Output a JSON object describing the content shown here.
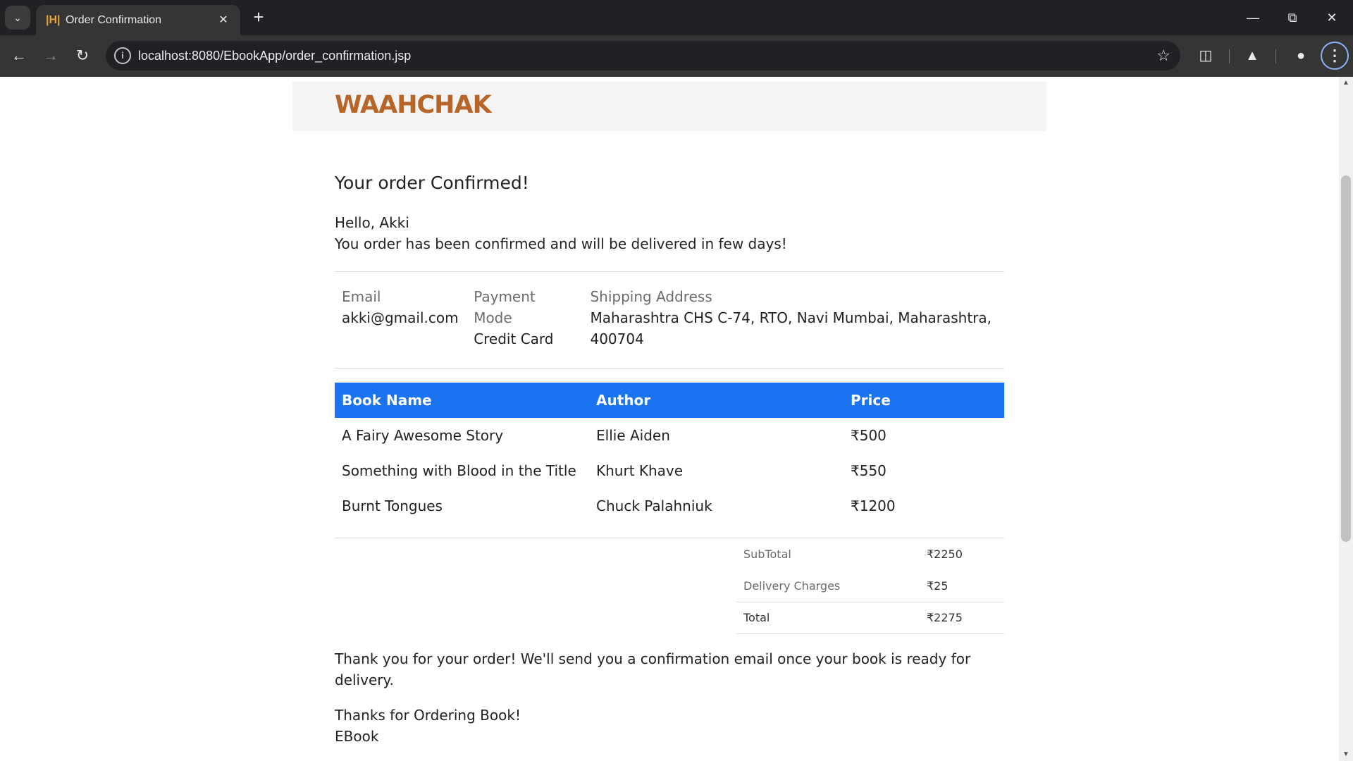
{
  "browser": {
    "tab_title": "Order Confirmation",
    "url": "localhost:8080/EbookApp/order_confirmation.jsp",
    "icons": {
      "tab_search": "chevron-down-icon",
      "favicon": "app-favicon-icon",
      "close": "close-icon",
      "new_tab": "plus-icon",
      "back": "arrow-left-icon",
      "forward": "arrow-right-icon",
      "reload": "reload-icon",
      "site_info": "info-icon",
      "bookmark": "star-icon",
      "extensions": "puzzle-icon",
      "labs": "flask-icon",
      "profile": "person-icon",
      "menu": "kebab-menu-icon"
    }
  },
  "site": {
    "logo_text": "WAAHCHAK",
    "logo_color": "#b8652a"
  },
  "order": {
    "title": "Your order Confirmed!",
    "greeting": "Hello, Akki",
    "message": "You order has been confirmed and will be delivered in few days!",
    "email_label": "Email",
    "email_value": "akki@gmail.com",
    "payment_label_1": "Payment",
    "payment_label_2": "Mode",
    "payment_value": "Credit Card",
    "address_label": "Shipping Address",
    "address_value": "Maharashtra CHS C-74, RTO, Navi Mumbai, Maharashtra, 400704"
  },
  "books_table": {
    "header_color": "#1a73f0",
    "headers": [
      "Book Name",
      "Author",
      "Price"
    ],
    "rows": [
      [
        "A Fairy Awesome Story",
        "Ellie Aiden",
        "₹500"
      ],
      [
        "Something with Blood in the Title",
        "Khurt Khave",
        "₹550"
      ],
      [
        "Burnt Tongues",
        "Chuck Palahniuk",
        "₹1200"
      ]
    ]
  },
  "totals": {
    "subtotal_label": "SubTotal",
    "subtotal_value": "₹2250",
    "delivery_label": "Delivery Charges",
    "delivery_value": "₹25",
    "total_label": "Total",
    "total_value": "₹2275"
  },
  "footer": {
    "thanks": "Thank you for your order! We'll send you a confirmation email once your book is ready for delivery.",
    "signoff_1": "Thanks for Ordering Book!",
    "signoff_2": "EBook"
  }
}
